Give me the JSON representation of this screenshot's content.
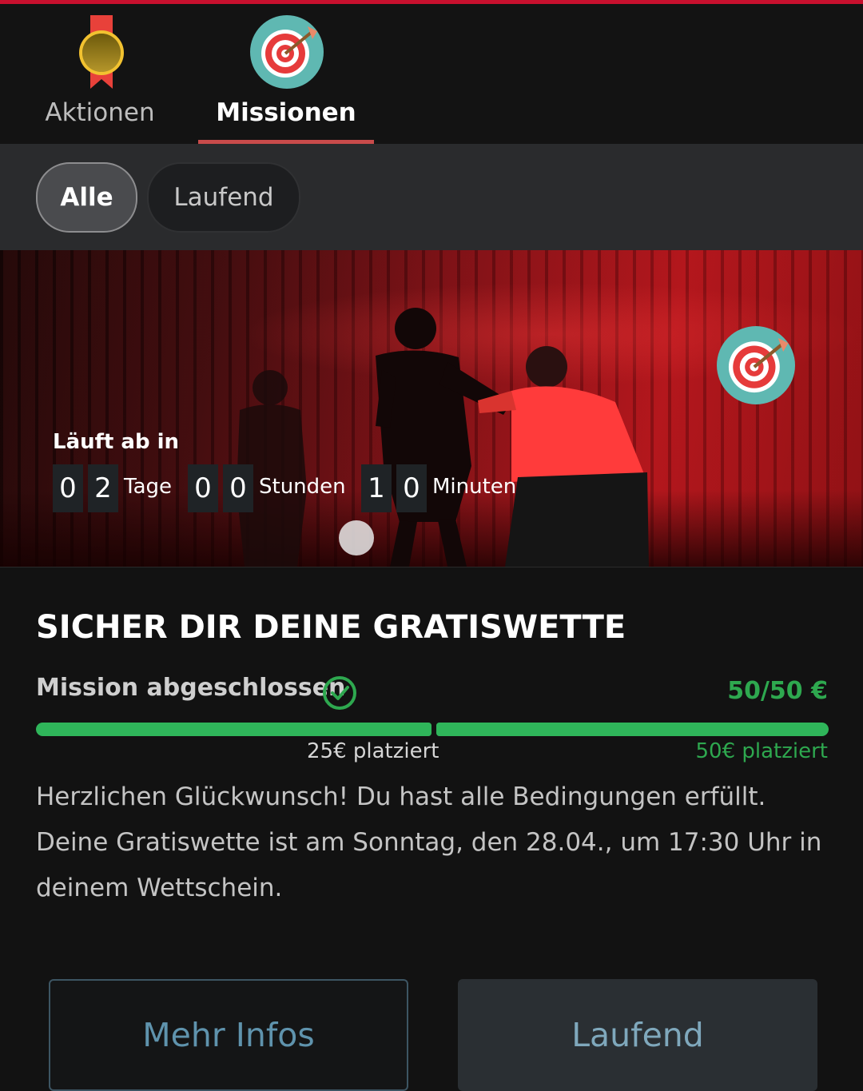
{
  "nav": {
    "tabs": [
      {
        "label": "Aktionen",
        "icon": "medal-icon",
        "active": false
      },
      {
        "label": "Missionen",
        "icon": "target-icon",
        "active": true
      }
    ]
  },
  "filters": {
    "chips": [
      {
        "label": "Alle",
        "active": true
      },
      {
        "label": "Laufend",
        "active": false
      }
    ]
  },
  "hero": {
    "badge_icon": "target-icon",
    "countdown_label": "Läuft ab in",
    "countdown": {
      "days": [
        "0",
        "2"
      ],
      "days_unit": "Tage",
      "hours": [
        "0",
        "0"
      ],
      "hours_unit": "Stunden",
      "minutes": [
        "1",
        "0"
      ],
      "minutes_unit": "Minuten"
    }
  },
  "mission": {
    "title": "SICHER DIR DEINE GRATISWETTE",
    "status": "Mission abgeschlossen",
    "status_icon": "check-circle-icon",
    "amount": "50/50 €",
    "progress": 1.0,
    "milestones": [
      "25€ platziert",
      "50€ platziert"
    ],
    "description": "Herzlichen Glückwunsch! Du hast alle Bedingungen erfüllt. Deine Gratiswette ist am Sonntag, den 28.04., um 17:30 Uhr in deinem Wettschein."
  },
  "buttons": {
    "more_info": "Mehr Infos",
    "running": "Laufend"
  },
  "colors": {
    "accent_red": "#c8102e",
    "progress_green": "#2fb55a",
    "button_blue": "#5f93ad"
  }
}
